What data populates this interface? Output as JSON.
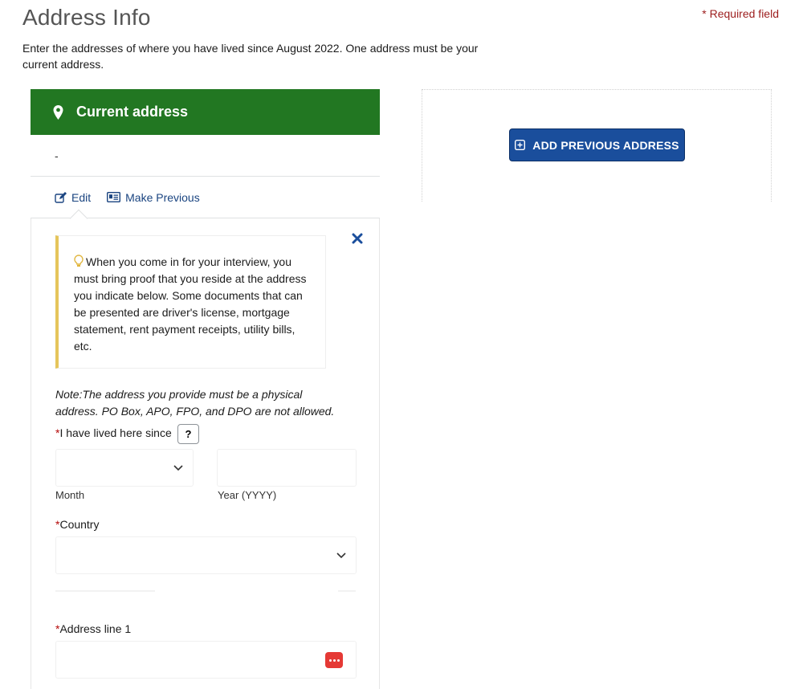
{
  "page": {
    "title": "Address Info",
    "required_note": "* Required field",
    "intro": "Enter the addresses of where you have lived since August 2022. One address must be your current address."
  },
  "current_address": {
    "header": "Current address",
    "summary": "-",
    "actions": {
      "edit": "Edit",
      "make_previous": "Make Previous"
    }
  },
  "form": {
    "alert_text": "When you come in for your interview, you must bring proof that you reside at the address you indicate below. Some documents that can be presented are driver's license, mortgage statement, rent payment receipts, utility bills, etc.",
    "note_prefix": "Note:",
    "note_text": "The address you provide must be a physical address. PO Box, APO, FPO, and DPO are not allowed.",
    "lived_since": {
      "required_mark": "*",
      "label": "I have lived here since",
      "help": "?"
    },
    "month": {
      "value": "",
      "label": "Month"
    },
    "year": {
      "value": "",
      "label": "Year (YYYY)"
    },
    "country": {
      "required_mark": "*",
      "label": "Country",
      "value": ""
    },
    "address_line_1": {
      "required_mark": "*",
      "label": "Address line 1",
      "value": ""
    }
  },
  "right_panel": {
    "add_button": "ADD PREVIOUS ADDRESS"
  },
  "colors": {
    "header_green": "#227722",
    "button_blue": "#1a4e9c",
    "required_red": "#b50909",
    "alert_border": "#e5c55b",
    "link_blue": "#1a4480"
  },
  "icons": [
    "map-pin-icon",
    "edit-icon",
    "id-card-icon",
    "close-icon",
    "lightbulb-icon",
    "chevron-down-icon",
    "password-manager-icon",
    "plus-square-icon"
  ]
}
